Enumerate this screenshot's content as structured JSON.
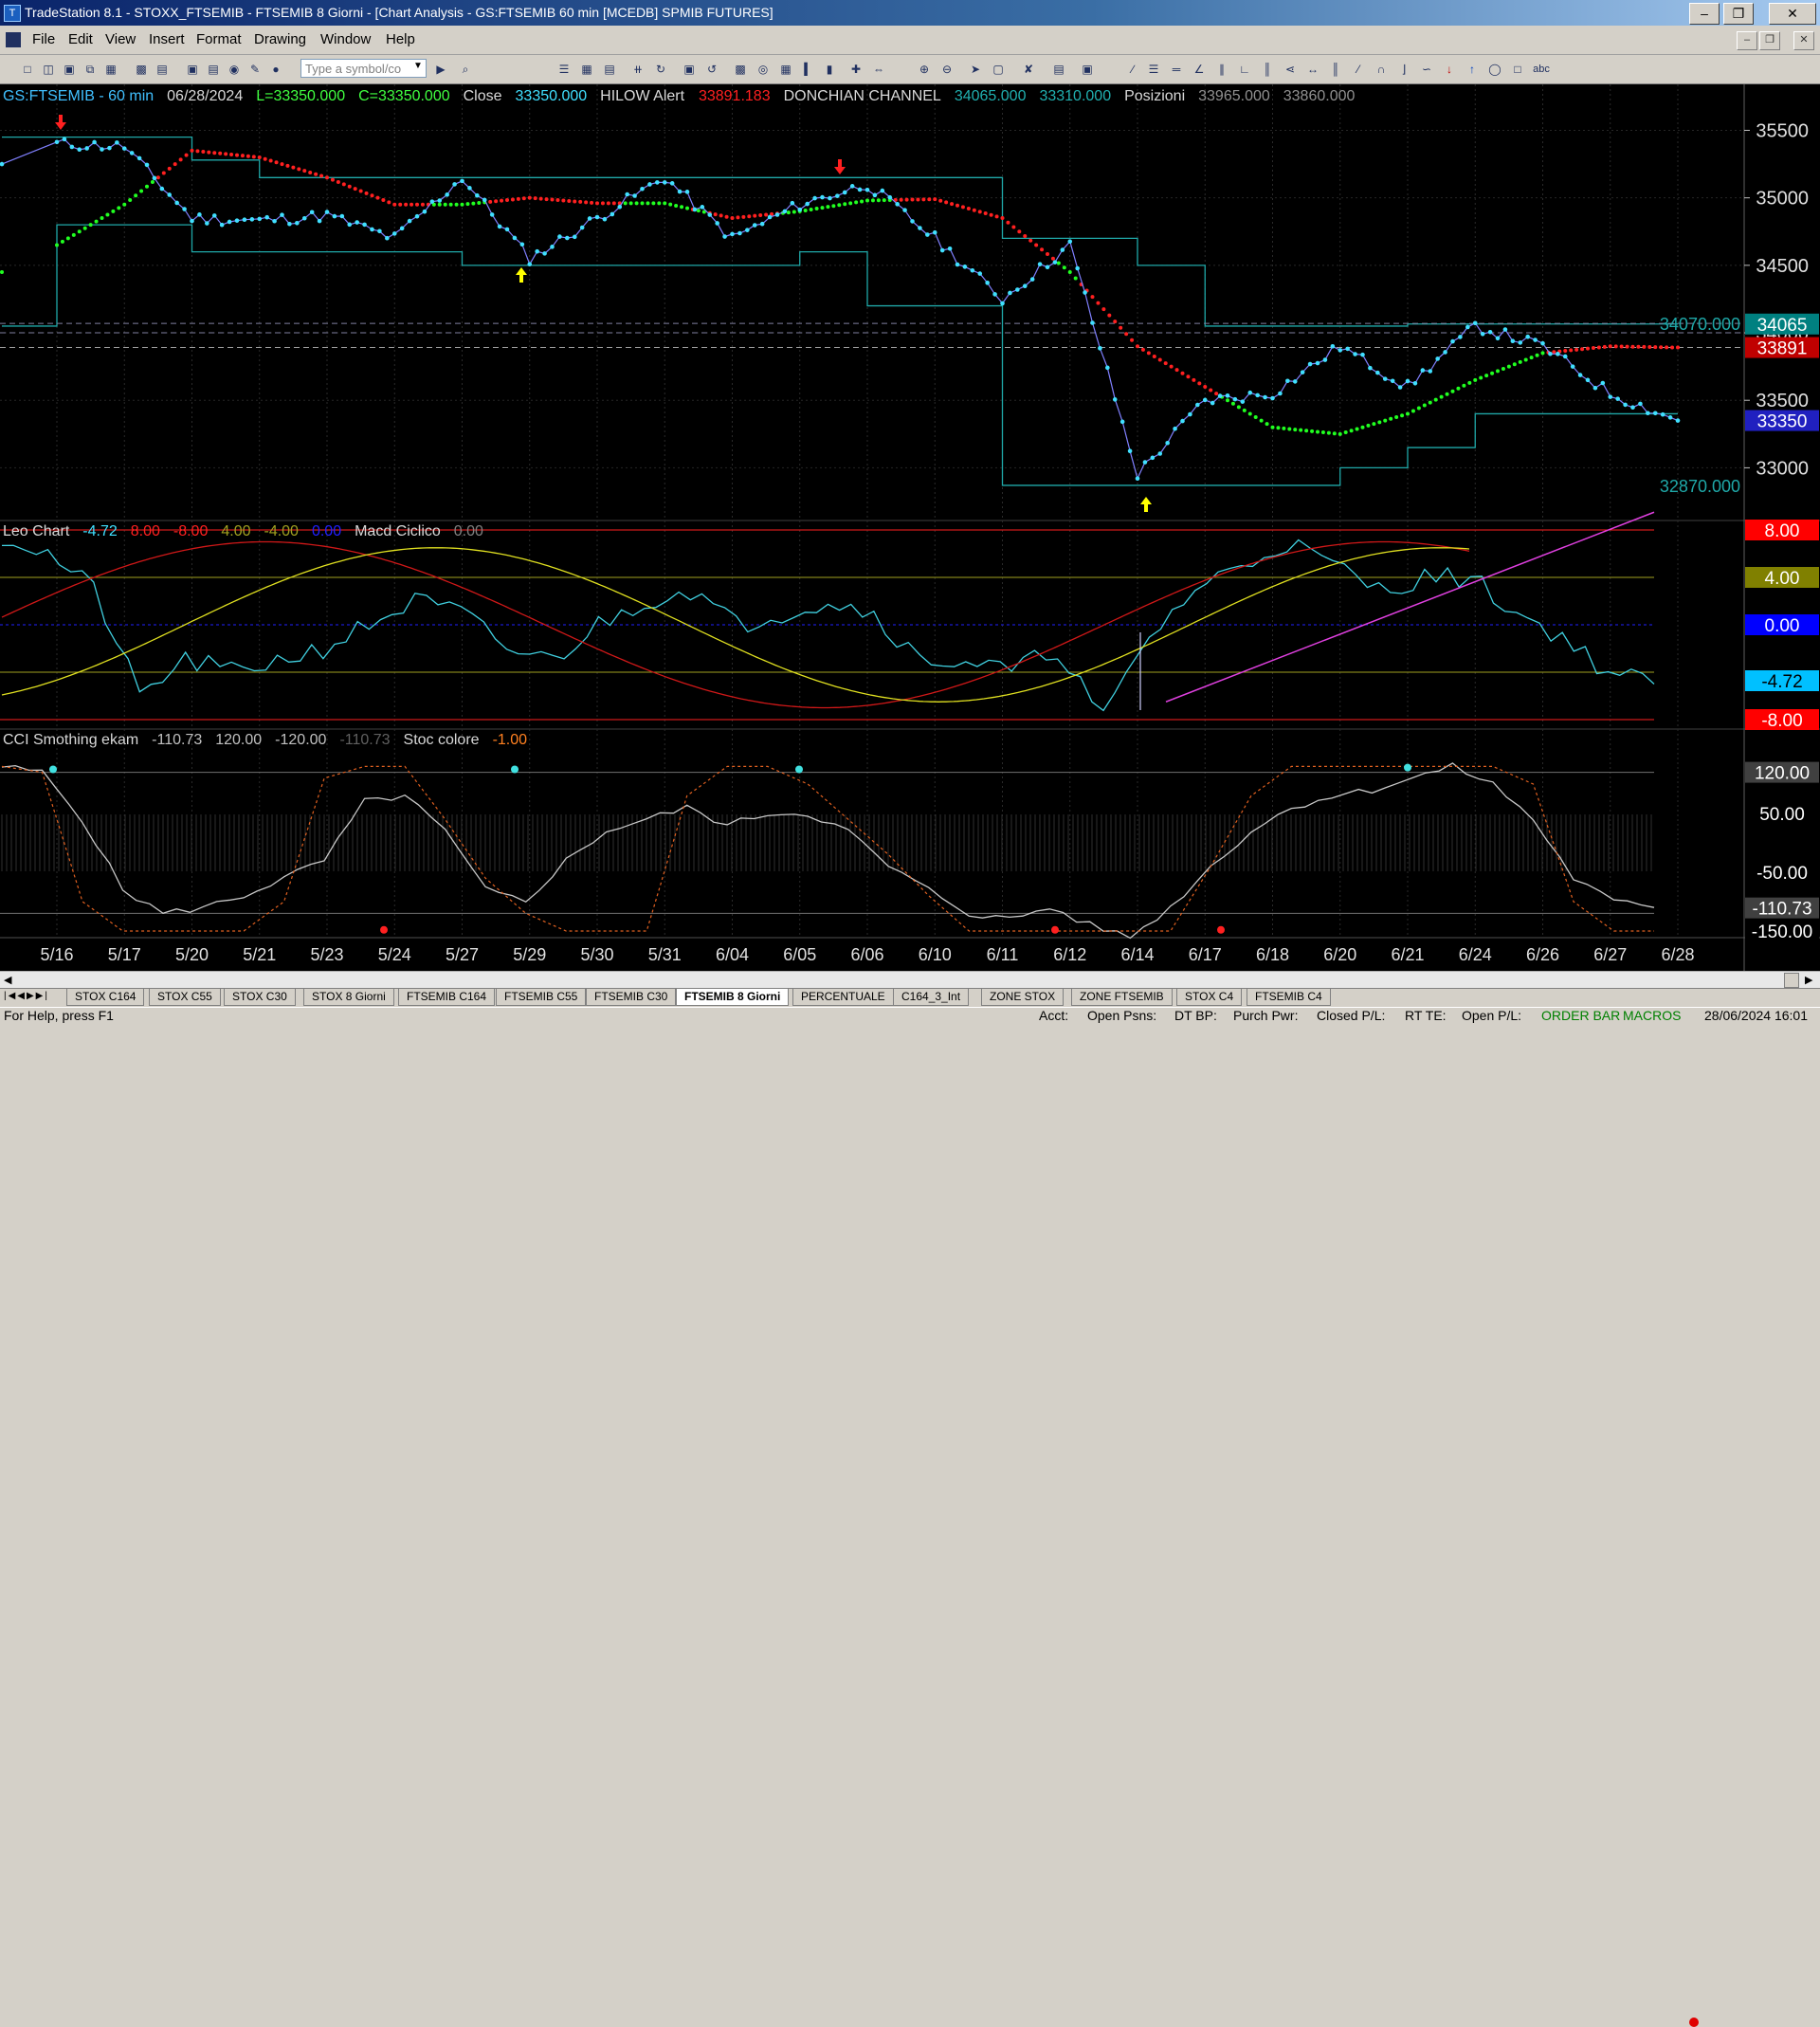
{
  "window": {
    "title": "TradeStation 8.1 - STOXX_FTSEMIB - FTSEMIB  8 Giorni - [Chart Analysis - GS:FTSEMIB  60 min  [MCEDB] SPMIB FUTURES]",
    "minimize_glyph": "–",
    "restore_glyph": "❐",
    "close_glyph": "✕"
  },
  "menu": {
    "items": [
      "File",
      "Edit",
      "View",
      "Insert",
      "Format",
      "Drawing",
      "Window",
      "Help"
    ],
    "mdi": [
      "–",
      "❐",
      "✕"
    ]
  },
  "toolbar": {
    "symbol_placeholder": "Type a symbol/co",
    "label_abc": "abc"
  },
  "price_pane": {
    "header": [
      {
        "text": "GS:FTSEMIB - 60 min",
        "color": "#40c0ff"
      },
      {
        "text": "06/28/2024",
        "color": "#d8d8d8"
      },
      {
        "text": "L=33350.000",
        "color": "#40ff40"
      },
      {
        "text": "C=33350.000",
        "color": "#40ff40"
      },
      {
        "text": "Close",
        "color": "#d8d8d8"
      },
      {
        "text": "33350.000",
        "color": "#40e0ff"
      },
      {
        "text": "HILOW Alert",
        "color": "#d8d8d8"
      },
      {
        "text": "33891.183",
        "color": "#ff2020"
      },
      {
        "text": "DONCHIAN CHANNEL",
        "color": "#d8d8d8"
      },
      {
        "text": "34065.000",
        "color": "#20b0b0"
      },
      {
        "text": "33310.000",
        "color": "#20b0b0"
      },
      {
        "text": "Posizioni",
        "color": "#d8d8d8"
      },
      {
        "text": "33965.000",
        "color": "#909090"
      },
      {
        "text": "33860.000",
        "color": "#909090"
      }
    ],
    "axis_ticks": [
      "35500",
      "35000",
      "34500",
      "34000",
      "33500",
      "33000"
    ],
    "level_labels": {
      "upper": "34070.000",
      "lower": "32870.000"
    },
    "price_badges": [
      {
        "text": "34065",
        "bg": "#008080",
        "fg": "#ffffff"
      },
      {
        "text": "33891",
        "bg": "#c00000",
        "fg": "#ffffff"
      },
      {
        "text": "33350",
        "bg": "#2020c0",
        "fg": "#ffffff"
      }
    ]
  },
  "leo_pane": {
    "header": [
      {
        "text": "Leo Chart",
        "color": "#d8d8d8"
      },
      {
        "text": "-4.72",
        "color": "#40e0ff"
      },
      {
        "text": "8.00",
        "color": "#ff2020"
      },
      {
        "text": "-8.00",
        "color": "#ff2020"
      },
      {
        "text": "4.00",
        "color": "#a0a020"
      },
      {
        "text": "-4.00",
        "color": "#a0a020"
      },
      {
        "text": "0.00",
        "color": "#2020ff"
      },
      {
        "text": "Macd Ciclico",
        "color": "#d8d8d8"
      },
      {
        "text": "0.00",
        "color": "#808080"
      }
    ],
    "badges": [
      {
        "text": "8.00",
        "bg": "#ff0000",
        "fg": "#ffffff"
      },
      {
        "text": "4.00",
        "bg": "#808000",
        "fg": "#ffffff"
      },
      {
        "text": "0.00",
        "bg": "#0000ff",
        "fg": "#ffffff"
      },
      {
        "text": "-4.72",
        "bg": "#00c0ff",
        "fg": "#000000"
      },
      {
        "text": "-8.00",
        "bg": "#ff0000",
        "fg": "#ffffff"
      }
    ]
  },
  "cci_pane": {
    "header": [
      {
        "text": "CCI Smothing ekam",
        "color": "#d8d8d8"
      },
      {
        "text": "-110.73",
        "color": "#c0c0c0"
      },
      {
        "text": "120.00",
        "color": "#c0c0c0"
      },
      {
        "text": "-120.00",
        "color": "#c0c0c0"
      },
      {
        "text": "-110.73",
        "color": "#606060"
      },
      {
        "text": "Stoc colore",
        "color": "#d8d8d8"
      },
      {
        "text": "-1.00",
        "color": "#ff8020"
      }
    ],
    "badges": [
      {
        "text": "120.00",
        "bg": "#404040",
        "fg": "#ffffff"
      },
      {
        "text": "50.00",
        "bg": "#000000",
        "fg": "#ffffff"
      },
      {
        "text": "-50.00",
        "bg": "#000000",
        "fg": "#ffffff"
      },
      {
        "text": "-110.73",
        "bg": "#404040",
        "fg": "#ffffff"
      },
      {
        "text": "-150.00",
        "bg": "#000000",
        "fg": "#ffffff"
      }
    ]
  },
  "x_axis_dates": [
    "5/16",
    "5/17",
    "5/20",
    "5/21",
    "5/23",
    "5/24",
    "5/27",
    "5/29",
    "5/30",
    "5/31",
    "6/04",
    "6/05",
    "6/06",
    "6/10",
    "6/11",
    "6/12",
    "6/14",
    "6/17",
    "6/18",
    "6/20",
    "6/21",
    "6/24",
    "6/26",
    "6/27",
    "6/28"
  ],
  "chart_data": {
    "type": "line",
    "title": "GS:FTSEMIB - 60 min",
    "x": [
      "5/16",
      "5/17",
      "5/20",
      "5/21",
      "5/23",
      "5/24",
      "5/27",
      "5/29",
      "5/30",
      "5/31",
      "6/04",
      "6/05",
      "6/06",
      "6/10",
      "6/11",
      "6/12",
      "6/14",
      "6/17",
      "6/18",
      "6/20",
      "6/21",
      "6/24",
      "6/26",
      "6/27",
      "6/28"
    ],
    "series": [
      {
        "name": "Close",
        "values": [
          35400,
          35380,
          34850,
          34830,
          34870,
          34700,
          35150,
          34550,
          34850,
          35150,
          34700,
          34950,
          35100,
          34700,
          34250,
          34650,
          32950,
          33500,
          33550,
          33900,
          33600,
          34050,
          33900,
          33550,
          33350
        ]
      },
      {
        "name": "HILOW Alert",
        "values": [
          34650,
          34950,
          35350,
          35300,
          35150,
          34950,
          34950,
          35000,
          34960,
          34960,
          34850,
          34900,
          34980,
          34990,
          34850,
          34450,
          33900,
          33600,
          33300,
          33250,
          33400,
          33650,
          33850,
          33900,
          33891
        ]
      },
      {
        "name": "DONCHIAN CHANNEL",
        "values": [
          34065,
          33310
        ]
      }
    ],
    "ylim": [
      32750,
      35700
    ],
    "last": {
      "L": 33350,
      "C": 33350,
      "Close": 33350,
      "HILOW Alert": 33891.183,
      "DONCHIAN CHANNEL": [
        34065,
        33310
      ],
      "Posizioni": [
        33965,
        33860
      ]
    }
  }
}
